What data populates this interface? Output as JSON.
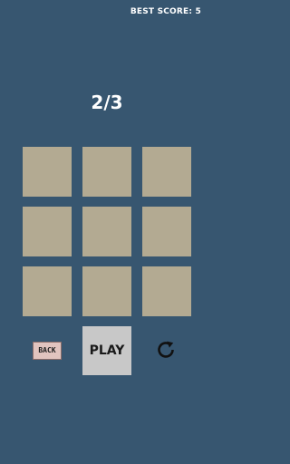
{
  "header": {
    "best_score_label": "BEST SCORE: 5"
  },
  "game": {
    "progress": "2/3",
    "tiles": [
      "",
      "",
      "",
      "",
      "",
      "",
      "",
      "",
      ""
    ]
  },
  "controls": {
    "back_label": "BACK",
    "play_label": "PLAY",
    "restart_icon": "restart-icon"
  },
  "colors": {
    "background": "#375670",
    "tile": "#b3aa92",
    "play_button": "#c8c8c8",
    "back_button": "#e1c4bf"
  }
}
